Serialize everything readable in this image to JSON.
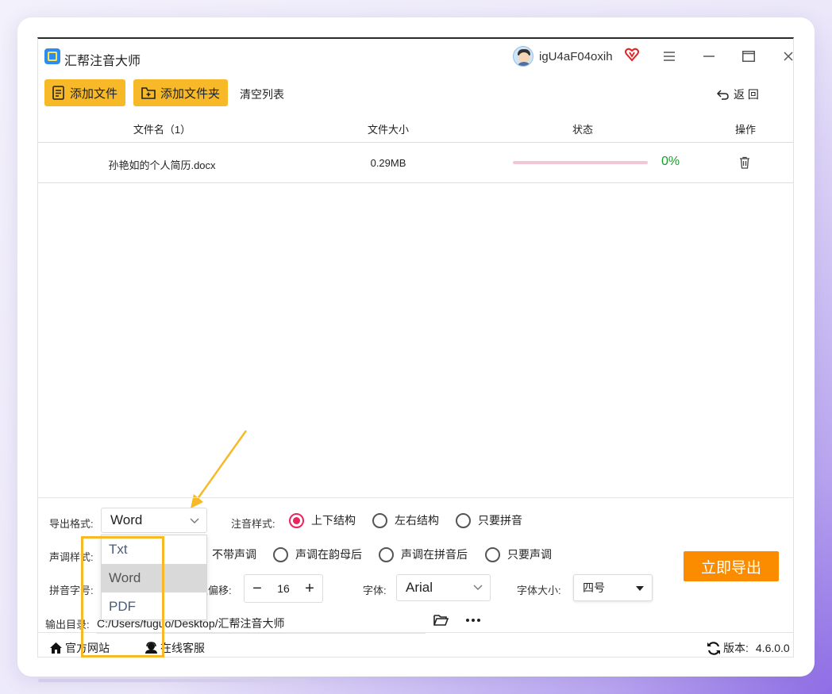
{
  "window": {
    "app_title": "汇帮注音大师",
    "username": "igU4aF04oxih"
  },
  "toolbar": {
    "add_file": "添加文件",
    "add_folder": "添加文件夹",
    "clear_list": "清空列表",
    "back": "返 回"
  },
  "table": {
    "headers": [
      "文件名（1）",
      "文件大小",
      "状态",
      "操作"
    ],
    "rows": [
      {
        "name": "孙艳如的个人简历.docx",
        "size": "0.29MB",
        "progress": 0,
        "percent": "0%"
      }
    ]
  },
  "settings": {
    "export_format_label": "导出格式:",
    "export_format_value": "Word",
    "export_format_options": [
      "Txt",
      "Word",
      "PDF"
    ],
    "annotation_style_label": "注音样式:",
    "annotation_styles": [
      "上下结构",
      "左右结构",
      "只要拼音"
    ],
    "annotation_style_selected": "上下结构",
    "tone_style_label": "声调样式:",
    "tone_styles": [
      "不带声调",
      "声调在韵母后",
      "声调在拼音后",
      "只要声调"
    ],
    "pinyin_size_label": "拼音字号:",
    "offset_label": "上偏移:",
    "offset_value": "16",
    "font_label": "字体:",
    "font_value": "Arial",
    "font_size_label": "字体大小:",
    "font_size_value": "四号",
    "output_dir_label": "输出目录:",
    "output_dir_value": "C:/Users/fuguo/Desktop/汇帮注音大师",
    "export_button": "立即导出"
  },
  "statusbar": {
    "official_site": "官方网站",
    "online_service": "在线客服",
    "version_label": "版本:",
    "version_value": "4.6.0.0"
  },
  "colors": {
    "accent_yellow": "#f7b928",
    "export_orange": "#fb8c00",
    "radio_red": "#e8255c",
    "percent_green": "#1a9c2a"
  }
}
